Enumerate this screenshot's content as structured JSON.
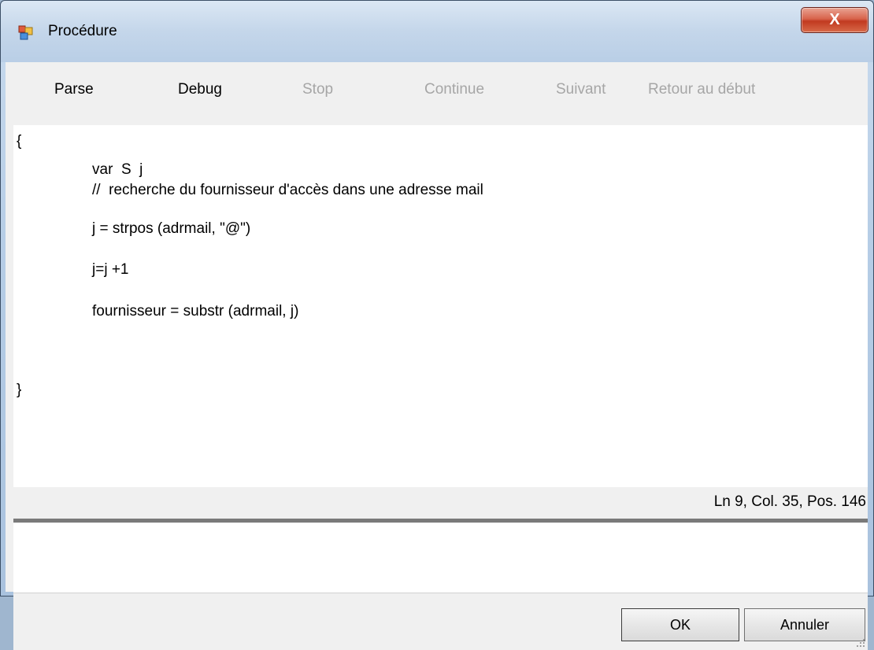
{
  "window": {
    "title": "Procédure",
    "close_label": "X"
  },
  "toolbar": {
    "items": [
      {
        "label": "Parse",
        "enabled": true
      },
      {
        "label": "Debug",
        "enabled": true
      },
      {
        "label": "Stop",
        "enabled": false
      },
      {
        "label": "Continue",
        "enabled": false
      },
      {
        "label": "Suivant",
        "enabled": false
      },
      {
        "label": "Retour au début",
        "enabled": false
      }
    ]
  },
  "editor": {
    "lines": [
      "{",
      "var  S  j",
      "//  recherche du fournisseur d'accès dans une adresse mail",
      "j = strpos (adrmail, \"@\")",
      "j=j +1",
      "fournisseur = substr (adrmail, j)",
      "}"
    ]
  },
  "status": {
    "position_text": "Ln 9, Col. 35, Pos. 146"
  },
  "output": {
    "text": ""
  },
  "buttons": {
    "ok_label": "OK",
    "cancel_label": "Annuler"
  },
  "colors": {
    "disabled_text": "#a6a6a6",
    "close_button": "#c13a20",
    "title_bar": "#c4d6ea"
  },
  "icons": {
    "app": "app-window-icon",
    "close": "close-icon",
    "grip": "resize-grip-icon"
  }
}
